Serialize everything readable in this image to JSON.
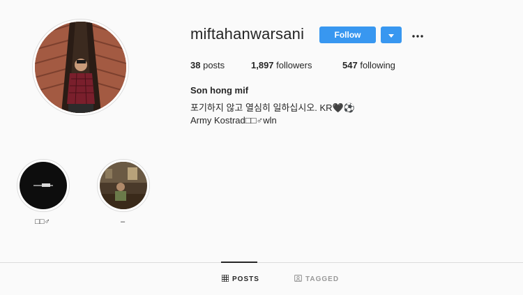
{
  "profile": {
    "username": "miftahanwarsani",
    "follow_label": "Follow",
    "dropdown_icon": "caret-down-icon",
    "more_icon": "more-dots-icon",
    "full_name": "Son hong mif",
    "bio_line_1": "포기하지 않고 열심히 일하십시오. KR🖤⚽",
    "bio_line_2": "Army Kostrad□□♂wln"
  },
  "stats": {
    "posts_count": "38",
    "posts_label": "posts",
    "followers_count": "1,897",
    "followers_label": "followers",
    "following_count": "547",
    "following_label": "following"
  },
  "highlights": [
    {
      "label": "□□♂"
    },
    {
      "label": "–"
    }
  ],
  "tabs": {
    "posts_label": "POSTS",
    "tagged_label": "TAGGED",
    "active": "posts"
  },
  "colors": {
    "accent": "#3897f0",
    "background": "#fafafa",
    "border": "#dbdbdb"
  }
}
